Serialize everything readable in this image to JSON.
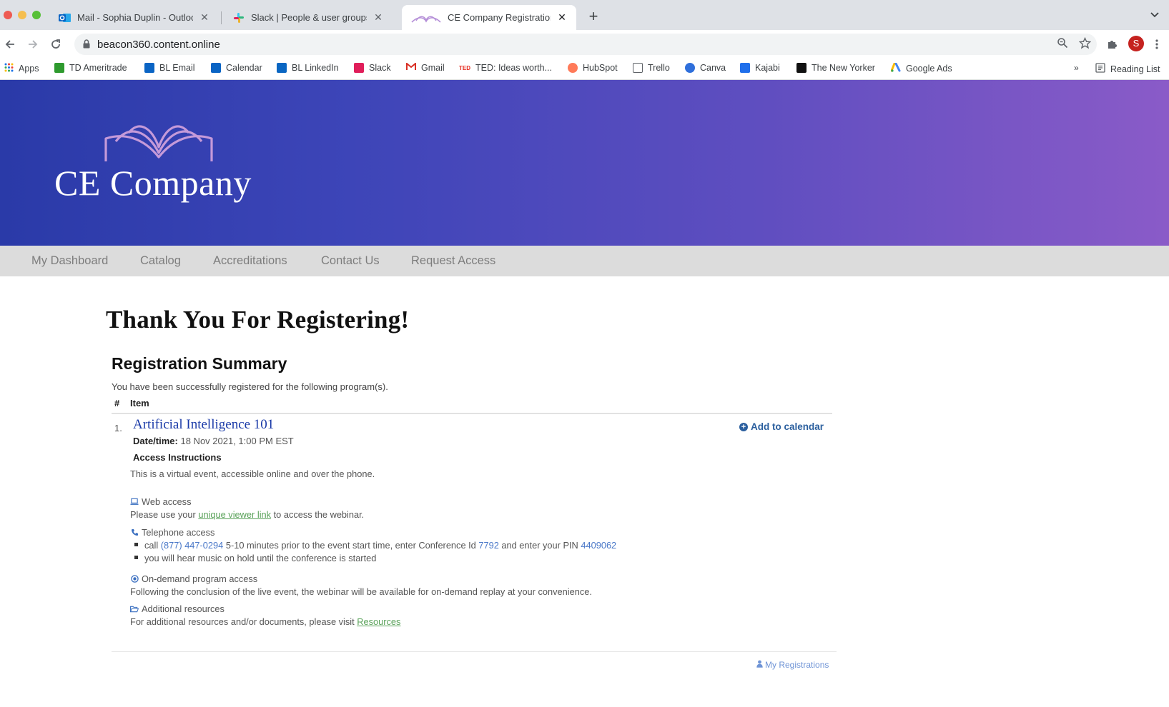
{
  "browser": {
    "tabs": [
      {
        "title": "Mail - Sophia Duplin - Outlook",
        "close": "✕",
        "icon": "outlook-icon"
      },
      {
        "title": "Slack | People & user groups |",
        "close": "✕",
        "icon": "slack-icon"
      },
      {
        "title": "CE Company Registration",
        "close": "✕",
        "icon": "book-icon",
        "active": true
      }
    ],
    "new_tab": "+",
    "url": "beacon360.content.online",
    "profile_initial": "S",
    "bookmarks": [
      {
        "label": "Apps",
        "icon": "apps-grid-icon",
        "color": "#1a73e8"
      },
      {
        "label": "TD Ameritrade",
        "icon": "td-icon",
        "color": "#2e9a2e"
      },
      {
        "label": "BL Email",
        "icon": "outlook-icon",
        "color": "#0a64c4"
      },
      {
        "label": "Calendar",
        "icon": "calendar-icon",
        "color": "#0a64c4"
      },
      {
        "label": "BL LinkedIn",
        "icon": "linkedin-icon",
        "color": "#0a66c2"
      },
      {
        "label": "Slack",
        "icon": "slack-icon",
        "color": "#e01e5a"
      },
      {
        "label": "Gmail",
        "icon": "gmail-icon",
        "color": "#d93025"
      },
      {
        "label": "TED: Ideas worth...",
        "icon": "ted-icon",
        "color": "#e62b1e"
      },
      {
        "label": "HubSpot",
        "icon": "hubspot-icon",
        "color": "#ff7a59"
      },
      {
        "label": "Trello",
        "icon": "trello-icon",
        "color": "#0079bf"
      },
      {
        "label": "Canva",
        "icon": "canva-icon",
        "color": "#00c4cc"
      },
      {
        "label": "Kajabi",
        "icon": "kajabi-icon",
        "color": "#1f6feb"
      },
      {
        "label": "The New Yorker",
        "icon": "new-yorker-icon",
        "color": "#111111"
      },
      {
        "label": "Google Ads",
        "icon": "google-ads-icon",
        "color": "#fbbc04"
      }
    ],
    "bookmarks_overflow": "»",
    "reading_list": "Reading List"
  },
  "site": {
    "brand": "CE Company",
    "nav": [
      "My Dashboard",
      "Catalog",
      "Accreditations",
      "Contact Us",
      "Request Access"
    ]
  },
  "main": {
    "title": "Thank You For Registering!",
    "summary": {
      "heading": "Registration Summary",
      "subtitle": "You have been successfully registered for the following program(s).",
      "col_num": "#",
      "col_item": "Item",
      "row_num": "1.",
      "program_title": "Artificial Intelligence 101",
      "add_calendar": "Add to calendar",
      "datetime_label": "Date/time:",
      "datetime_value": "18 Nov 2021, 1:00 PM EST",
      "access_heading": "Access Instructions",
      "access_text": "This is a virtual event, accessible online and over the phone.",
      "web_access_heading": "Web access",
      "web_access_pre": "Please use your ",
      "web_access_link": "unique viewer link",
      "web_access_post": " to access the webinar.",
      "phone_heading": "Telephone access",
      "phone_b1_pre": "call ",
      "phone_number": "(877) 447-0294",
      "phone_b1_mid": " 5-10 minutes prior to the event start time, enter Conference Id ",
      "conference_id": "7792",
      "phone_b1_mid2": " and enter your PIN ",
      "pin": "4409062",
      "phone_b2": "you will hear music on hold until the conference is started",
      "ondemand_heading": "On-demand program access",
      "ondemand_text": "Following the conclusion of the live event, the webinar will be available for on-demand replay at your convenience.",
      "resources_heading": "Additional resources",
      "resources_pre": "For additional resources and/or documents, please visit ",
      "resources_link": "Resources",
      "my_registrations": "My Registrations"
    }
  }
}
